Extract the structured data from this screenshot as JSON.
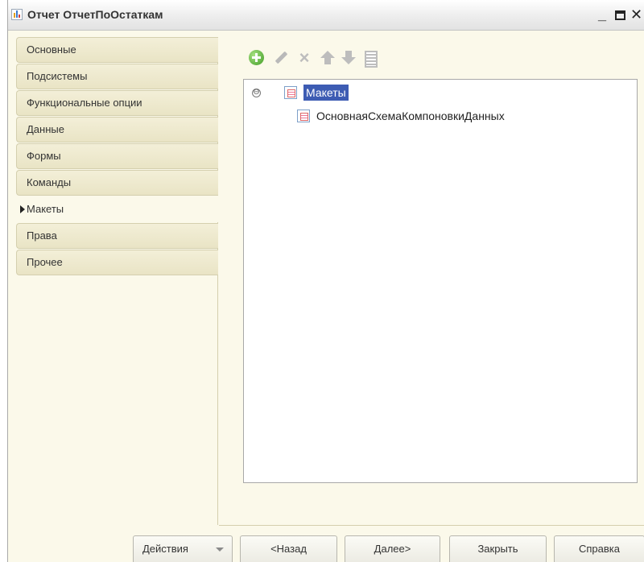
{
  "window": {
    "title": "Отчет ОтчетПоОстаткам",
    "controls": {
      "minimize": "_",
      "close": "✕"
    }
  },
  "tabs": [
    {
      "label": "Основные",
      "active": false
    },
    {
      "label": "Подсистемы",
      "active": false
    },
    {
      "label": "Функциональные опции",
      "active": false
    },
    {
      "label": "Данные",
      "active": false
    },
    {
      "label": "Формы",
      "active": false
    },
    {
      "label": "Команды",
      "active": false
    },
    {
      "label": "Макеты",
      "active": true
    },
    {
      "label": "Права",
      "active": false
    },
    {
      "label": "Прочее",
      "active": false
    }
  ],
  "toolbar": {
    "icons": [
      "add-icon",
      "edit-icon",
      "delete-icon",
      "move-up-icon",
      "move-down-icon",
      "sort-icon"
    ]
  },
  "tree": {
    "root": {
      "label": "Макеты",
      "expander": "⊖",
      "expanded": true,
      "selected": true
    },
    "children": [
      {
        "label": "ОсновнаяСхемаКомпоновкиДанных"
      }
    ]
  },
  "footer": {
    "actions_label": "Действия",
    "back_label": "<Назад",
    "next_label": "Далее>",
    "close_label": "Закрыть",
    "help_label": "Справка"
  },
  "colors": {
    "window_bg": "#fbf9ea",
    "tab_bg": "#ece7c9",
    "selection": "#3d5cb3",
    "add_icon": "#3f9b24"
  }
}
